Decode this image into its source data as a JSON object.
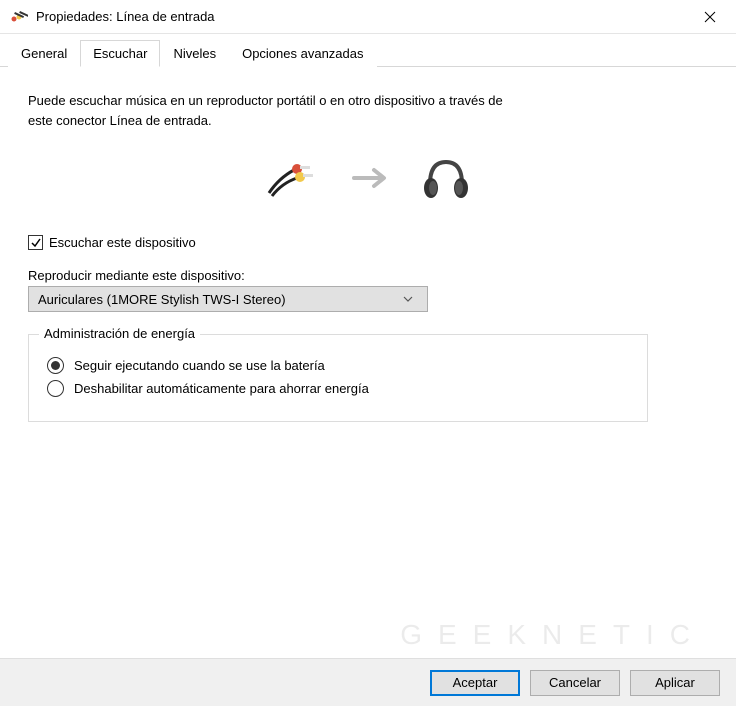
{
  "titlebar": {
    "title": "Propiedades: Línea de entrada"
  },
  "tabs": [
    {
      "label": "General"
    },
    {
      "label": "Escuchar"
    },
    {
      "label": "Niveles"
    },
    {
      "label": "Opciones avanzadas"
    }
  ],
  "content": {
    "description": "Puede escuchar música en un reproductor portátil o en otro dispositivo a través de este conector Línea de entrada.",
    "listen_checkbox_label": "Escuchar este dispositivo",
    "playback_label": "Reproducir mediante este dispositivo:",
    "playback_selected": "Auriculares (1MORE Stylish TWS-I Stereo)",
    "power_group_title": "Administración de energía",
    "power_radio_keep_running": "Seguir ejecutando cuando se use la batería",
    "power_radio_disable": "Deshabilitar automáticamente para ahorrar energía"
  },
  "footer": {
    "ok": "Aceptar",
    "cancel": "Cancelar",
    "apply": "Aplicar"
  },
  "watermark": "GEEKNETIC"
}
